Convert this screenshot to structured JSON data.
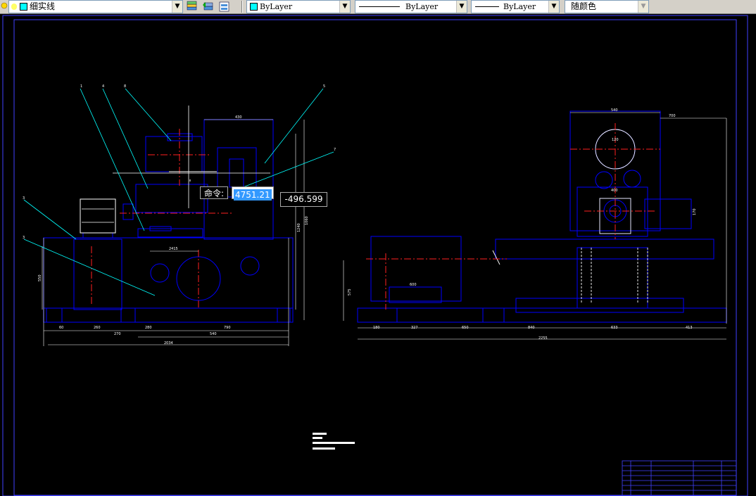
{
  "toolbar": {
    "linetype_value": "细实线",
    "layer_color": "ByLayer",
    "linetype_combo": "ByLayer",
    "lineweight_combo": "ByLayer",
    "plotstyle_combo": "随颜色"
  },
  "command": {
    "prompt": "命令:",
    "x_value": "4751.21",
    "y_value": "-496.599"
  },
  "colors": {
    "background": "#000000",
    "outline": "#0000ff",
    "leader": "#00ffff",
    "centerline": "#ff0000",
    "swatch": "#00ffff"
  },
  "drawing": {
    "left_view": {
      "balloons": [
        "1",
        "4",
        "8",
        "5",
        "7",
        "3",
        "3"
      ],
      "dims_bottom": [
        "60",
        "260",
        "280",
        "790"
      ],
      "dims_bottom_2": [
        "270",
        "540"
      ],
      "overall_width": "2034",
      "top_dim": "430",
      "inner_dim": "2415",
      "side_dims": [
        "1240",
        "1060",
        "550"
      ]
    },
    "right_view": {
      "top_dims": [
        "540",
        "700"
      ],
      "dims_bottom": [
        "180",
        "327",
        "650",
        "840",
        "633",
        "413"
      ],
      "overall_width": "2255",
      "inner_dims": [
        "600",
        "400",
        "120"
      ],
      "side_dims": [
        "575",
        "170"
      ]
    }
  }
}
